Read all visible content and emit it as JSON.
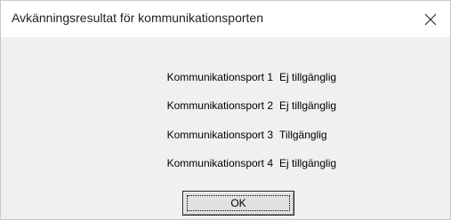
{
  "window": {
    "title": "Avkänningsresultat för kommunikationsporten",
    "close_icon": "close-icon"
  },
  "ports": [
    {
      "name": "Kommunikationsport 1",
      "status": "Ej tillgänglig"
    },
    {
      "name": "Kommunikationsport 2",
      "status": "Ej tillgänglig"
    },
    {
      "name": "Kommunikationsport 3",
      "status": "Tillgänglig"
    },
    {
      "name": "Kommunikationsport 4",
      "status": "Ej tillgänglig"
    }
  ],
  "buttons": {
    "ok_label": "OK"
  },
  "colors": {
    "title_bar": "#ffffff",
    "client_background": "#f0f0f0",
    "button_face": "#e1e1e1"
  }
}
